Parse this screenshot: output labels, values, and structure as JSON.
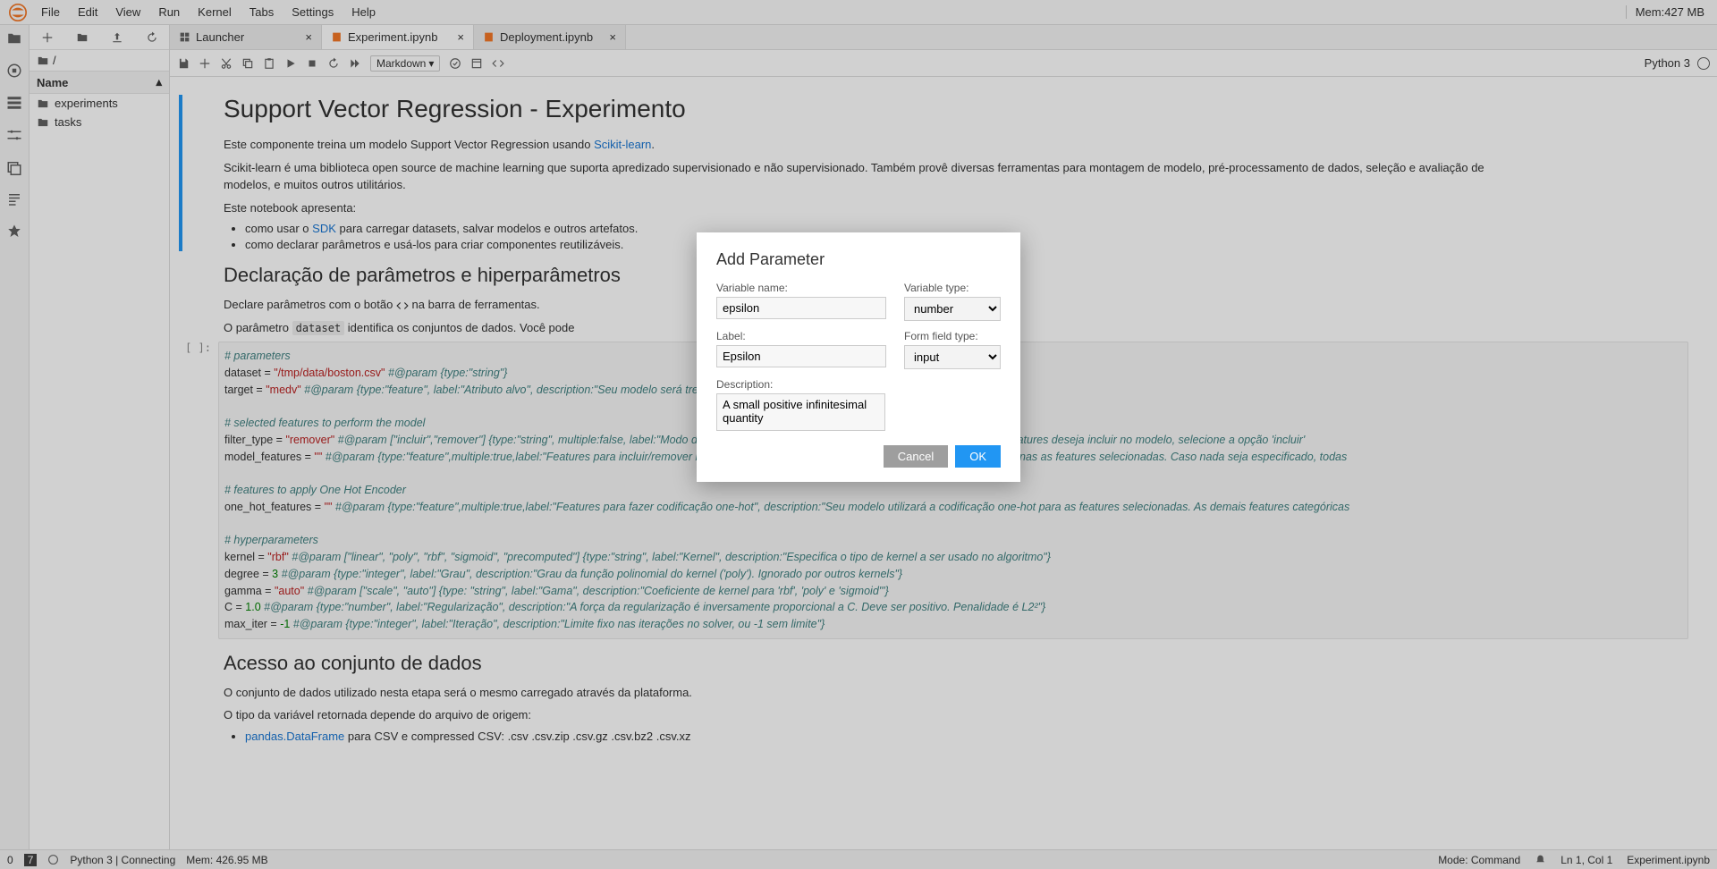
{
  "menubar": {
    "items": [
      "File",
      "Edit",
      "View",
      "Run",
      "Kernel",
      "Tabs",
      "Settings",
      "Help"
    ],
    "mem": "Mem:427 MB"
  },
  "tabs": [
    {
      "label": "Launcher",
      "icon": "launcher"
    },
    {
      "label": "Experiment.ipynb",
      "icon": "notebook",
      "active": true
    },
    {
      "label": "Deployment.ipynb",
      "icon": "notebook"
    }
  ],
  "filebrowser": {
    "breadcrumb": "/",
    "name_header": "Name",
    "items": [
      "experiments",
      "tasks"
    ]
  },
  "nb_toolbar": {
    "celltype": "Markdown",
    "kernel": "Python 3"
  },
  "notebook": {
    "h1": "Support Vector Regression - Experimento",
    "p1a": "Este componente treina um modelo Support Vector Regression usando ",
    "p1link": "Scikit-learn",
    "p1b": ".",
    "p2": "Scikit-learn é uma biblioteca open source de machine learning que suporta apredizado supervisionado e não supervisionado. Também provê diversas ferramentas para montagem de modelo, pré-processamento de dados, seleção e avaliação de modelos, e muitos outros utilitários.",
    "p3": "Este notebook apresenta:",
    "li1a": "como usar o ",
    "li1link": "SDK",
    "li1b": " para carregar datasets, salvar modelos e outros artefatos.",
    "li2": "como declarar parâmetros e usá-los para criar componentes reutilizáveis.",
    "h2a": "Declaração de parâmetros e hiperparâmetros",
    "p4a": "Declare parâmetros com o botão ",
    "p4b": " na barra de ferramentas.",
    "p5a": "O parâmetro ",
    "p5code": "dataset",
    "p5b": " identifica os conjuntos de dados. Você pode",
    "h2b": "Acesso ao conjunto de dados",
    "p6": "O conjunto de dados utilizado nesta etapa será o mesmo carregado através da plataforma.",
    "p7": "O tipo da variável retornada depende do arquivo de origem:",
    "li3link": "pandas.DataFrame",
    "li3b": " para CSV e compressed CSV: .csv .csv.zip .csv.gz .csv.bz2 .csv.xz"
  },
  "code": {
    "prompt": "[ ]:",
    "c1": "# parameters",
    "l1a": "dataset = ",
    "l1s": "\"/tmp/data/boston.csv\"",
    "l1c": " #@param {type:\"string\"}",
    "l2a": "target = ",
    "l2s": "\"medv\"",
    "l2c": " #@param {type:\"feature\", label:\"Atributo alvo\", description:\"Seu modelo será treinado para prever os valores do alvo.\"}",
    "c2": "# selected features to perform the model",
    "l3a": "filter_type = ",
    "l3s": "\"remover\"",
    "l3c": " #@param [\"incluir\",\"remover\"] {type:\"string\", multiple:false, label:\"Modo de seleção das features\", description:\"Se deseja informar quais features deseja incluir no modelo, selecione a opção 'incluir'",
    "l4a": "model_features = ",
    "l4s": "\"\"",
    "l4c": " #@param {type:\"feature\",multiple:true,label:\"Features para incluir/remover no modelo\", description:\"Seu modelo será feito considerando apenas as features selecionadas. Caso nada seja especificado, todas",
    "c3": "# features to apply One Hot Encoder",
    "l5a": "one_hot_features = ",
    "l5s": "\"\"",
    "l5c": " #@param {type:\"feature\",multiple:true,label:\"Features para fazer codificação one-hot\", description:\"Seu modelo utilizará a codificação one-hot para as features selecionadas. As demais features categóricas",
    "c4": "# hyperparameters",
    "l6a": "kernel = ",
    "l6s": "\"rbf\"",
    "l6c": " #@param [\"linear\", \"poly\", \"rbf\", \"sigmoid\", \"precomputed\"] {type:\"string\", label:\"Kernel\", description:\"Especifica o tipo de kernel a ser usado no algoritmo\"}",
    "l7a": "degree = ",
    "l7n": "3",
    "l7c": " #@param {type:\"integer\", label:\"Grau\", description:\"Grau da função polinomial do kernel ('poly'). Ignorado por outros kernels\"}",
    "l8a": "gamma = ",
    "l8s": "\"auto\"",
    "l8c": " #@param [\"scale\", \"auto\"] {type: \"string\", label:\"Gama\", description:\"Coeficiente de kernel para 'rbf', 'poly' e 'sigmoid'\"}",
    "l9a": "C = ",
    "l9n": "1.0",
    "l9c": " #@param {type:\"number\", label:\"Regularização\", description:\"A força da regularização é inversamente proporcional a C. Deve ser positivo. Penalidade é L2²\"}",
    "l10a": "max_iter = ",
    "l10n": "-1",
    "l10c": " #@param {type:\"integer\", label:\"Iteração\", description:\"Limite fixo nas iterações no solver, ou -1 sem limite\"}"
  },
  "modal": {
    "title": "Add Parameter",
    "var_name_label": "Variable name:",
    "var_name": "epsilon",
    "var_type_label": "Variable type:",
    "var_type": "number",
    "label_label": "Label:",
    "label": "Epsilon",
    "field_type_label": "Form field type:",
    "field_type": "input",
    "desc_label": "Description:",
    "desc": "A small positive infinitesimal quantity",
    "cancel": "Cancel",
    "ok": "OK"
  },
  "statusbar": {
    "left1": "0",
    "left2": "7",
    "kernel": "Python 3 | Connecting",
    "mem": "Mem: 426.95 MB",
    "mode": "Mode: Command",
    "pos": "Ln 1, Col 1",
    "file": "Experiment.ipynb"
  }
}
